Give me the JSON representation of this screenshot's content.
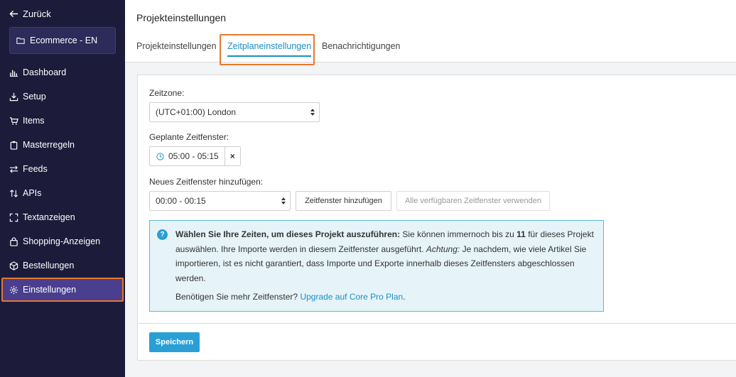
{
  "sidebar": {
    "back_label": "Zurück",
    "project_name": "Ecommerce - EN",
    "items": [
      {
        "label": "Dashboard",
        "icon": "bar-chart-icon"
      },
      {
        "label": "Setup",
        "icon": "download-icon"
      },
      {
        "label": "Items",
        "icon": "cart-icon"
      },
      {
        "label": "Masterregeln",
        "icon": "clipboard-icon"
      },
      {
        "label": "Feeds",
        "icon": "arrows-icon"
      },
      {
        "label": "APIs",
        "icon": "sort-icon"
      },
      {
        "label": "Textanzeigen",
        "icon": "expand-icon"
      },
      {
        "label": "Shopping-Anzeigen",
        "icon": "bag-icon"
      },
      {
        "label": "Bestellungen",
        "icon": "box-icon"
      },
      {
        "label": "Einstellungen",
        "icon": "gear-icon"
      }
    ],
    "active_item": "Einstellungen"
  },
  "header": {
    "title": "Projekteinstellungen",
    "tabs": [
      {
        "label": "Projekteinstellungen"
      },
      {
        "label": "Zeitplaneinstellungen"
      },
      {
        "label": "Benachrichtigungen"
      }
    ],
    "active_tab": "Zeitplaneinstellungen"
  },
  "form": {
    "timezone_label": "Zeitzone:",
    "timezone_value": "(UTC+01:00) London",
    "scheduled_label": "Geplante Zeitfenster:",
    "scheduled_slot": "05:00 - 05:15",
    "remove_symbol": "×",
    "new_label": "Neues Zeitfenster hinzufügen:",
    "new_value": "00:00 - 00:15",
    "add_button": "Zeitfenster hinzufügen",
    "use_all_button": "Alle verfügbaren Zeitfenster verwenden"
  },
  "info": {
    "icon_symbol": "?",
    "bold": "Wählen Sie Ihre Zeiten, um dieses Projekt auszuführen:",
    "text_1": " Sie können immernoch bis zu ",
    "count": "11",
    "text_2": " für dieses Projekt auswählen. Ihre Importe werden in diesem Zeitfenster ausgeführt. ",
    "italic": "Achtung:",
    "text_3": " Je nachdem, wie viele Artikel Sie importieren, ist es nicht garantiert, dass Importe und Exporte innerhalb dieses Zeitfensters abgeschlossen werden.",
    "footer_text": "Benötigen Sie mehr Zeitfenster? ",
    "footer_link": "Upgrade auf Core Pro Plan",
    "footer_end": "."
  },
  "save_button": "Speichern",
  "colors": {
    "sidebar_bg": "#1c1b3a",
    "active_bg": "#4a3e8e",
    "highlight": "#e8782a",
    "accent": "#2a9fd6",
    "link": "#1b8fc4"
  }
}
